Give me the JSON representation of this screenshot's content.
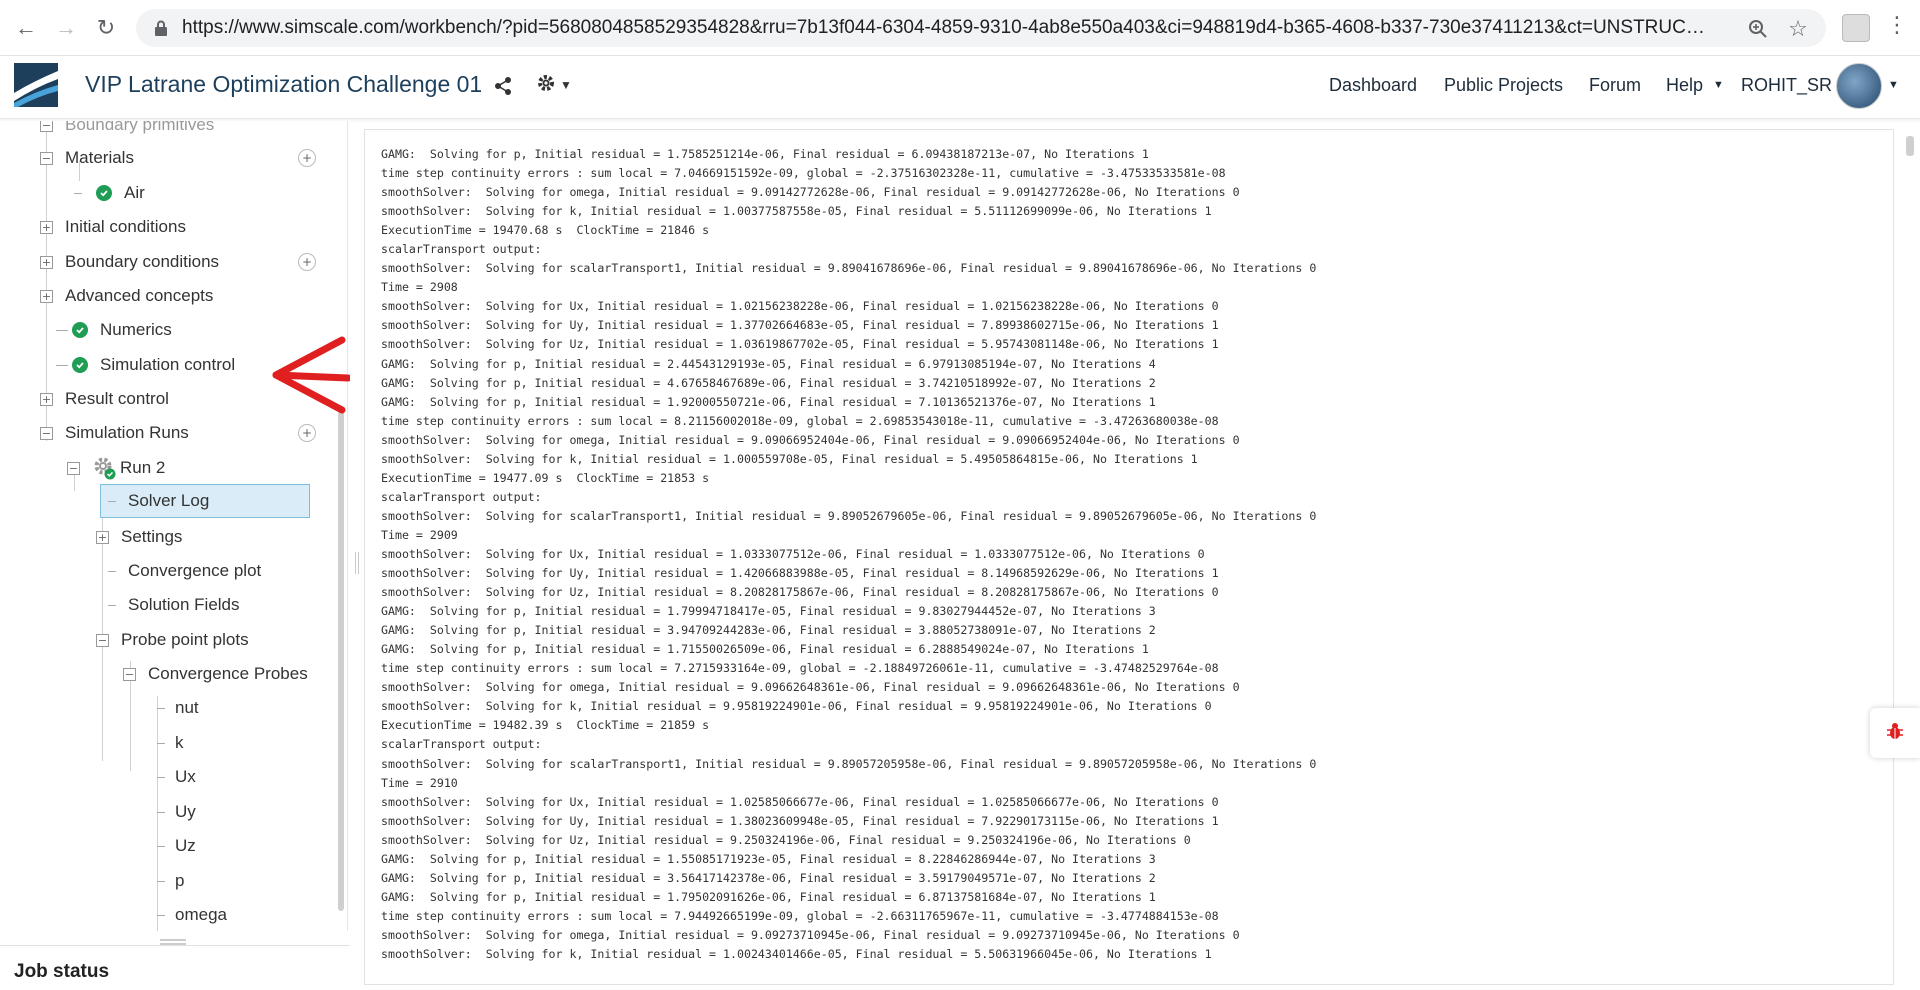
{
  "browser": {
    "url": "https://www.simscale.com/workbench/?pid=5680804858529354828&rru=7b13f044-6304-4859-9310-4ab8e550a403&ci=948819d4-b365-4608-b337-730e37411213&ct=UNSTRUCTURED_LOG&mt=SI..."
  },
  "header": {
    "project_title": "VIP Latrane Optimization Challenge 01",
    "nav": [
      "Dashboard",
      "Public Projects",
      "Forum",
      "Help"
    ],
    "username": "ROHIT_SR"
  },
  "sidebar": {
    "cut_item": "Boundary primitives",
    "materials": "Materials",
    "air": "Air",
    "initial_conditions": "Initial conditions",
    "boundary_conditions": "Boundary conditions",
    "advanced_concepts": "Advanced concepts",
    "numerics": "Numerics",
    "simulation_control": "Simulation control",
    "result_control": "Result control",
    "simulation_runs": "Simulation Runs",
    "run": "Run 2",
    "solver_log": "Solver Log",
    "settings": "Settings",
    "convergence_plot": "Convergence plot",
    "solution_fields": "Solution Fields",
    "probe_point_plots": "Probe point plots",
    "convergence_probes": "Convergence Probes",
    "probes": [
      "nut",
      "k",
      "Ux",
      "Uy",
      "Uz",
      "p",
      "omega"
    ]
  },
  "job_status": "Job status",
  "log": [
    "GAMG:  Solving for p, Initial residual = 1.7585251214e-06, Final residual = 6.09438187213e-07, No Iterations 1",
    "time step continuity errors : sum local = 7.04669151592e-09, global = -2.37516302328e-11, cumulative = -3.47533533581e-08",
    "smoothSolver:  Solving for omega, Initial residual = 9.09142772628e-06, Final residual = 9.09142772628e-06, No Iterations 0",
    "smoothSolver:  Solving for k, Initial residual = 1.00377587558e-05, Final residual = 5.51112699099e-06, No Iterations 1",
    "ExecutionTime = 19470.68 s  ClockTime = 21846 s",
    "scalarTransport output:",
    "smoothSolver:  Solving for scalarTransport1, Initial residual = 9.89041678696e-06, Final residual = 9.89041678696e-06, No Iterations 0",
    "Time = 2908",
    "smoothSolver:  Solving for Ux, Initial residual = 1.02156238228e-06, Final residual = 1.02156238228e-06, No Iterations 0",
    "smoothSolver:  Solving for Uy, Initial residual = 1.37702664683e-05, Final residual = 7.89938602715e-06, No Iterations 1",
    "smoothSolver:  Solving for Uz, Initial residual = 1.03619867702e-05, Final residual = 5.95743081148e-06, No Iterations 1",
    "GAMG:  Solving for p, Initial residual = 2.44543129193e-05, Final residual = 6.97913085194e-07, No Iterations 4",
    "GAMG:  Solving for p, Initial residual = 4.67658467689e-06, Final residual = 3.74210518992e-07, No Iterations 2",
    "GAMG:  Solving for p, Initial residual = 1.92000550721e-06, Final residual = 7.10136521376e-07, No Iterations 1",
    "time step continuity errors : sum local = 8.21156002018e-09, global = 2.69853543018e-11, cumulative = -3.47263680038e-08",
    "smoothSolver:  Solving for omega, Initial residual = 9.09066952404e-06, Final residual = 9.09066952404e-06, No Iterations 0",
    "smoothSolver:  Solving for k, Initial residual = 1.000559708e-05, Final residual = 5.49505864815e-06, No Iterations 1",
    "ExecutionTime = 19477.09 s  ClockTime = 21853 s",
    "scalarTransport output:",
    "smoothSolver:  Solving for scalarTransport1, Initial residual = 9.89052679605e-06, Final residual = 9.89052679605e-06, No Iterations 0",
    "Time = 2909",
    "smoothSolver:  Solving for Ux, Initial residual = 1.0333077512e-06, Final residual = 1.0333077512e-06, No Iterations 0",
    "smoothSolver:  Solving for Uy, Initial residual = 1.42066883988e-05, Final residual = 8.14968592629e-06, No Iterations 1",
    "smoothSolver:  Solving for Uz, Initial residual = 8.20828175867e-06, Final residual = 8.20828175867e-06, No Iterations 0",
    "GAMG:  Solving for p, Initial residual = 1.79994718417e-05, Final residual = 9.83027944452e-07, No Iterations 3",
    "GAMG:  Solving for p, Initial residual = 3.94709244283e-06, Final residual = 3.88052738091e-07, No Iterations 2",
    "GAMG:  Solving for p, Initial residual = 1.71550026509e-06, Final residual = 6.2888549024e-07, No Iterations 1",
    "time step continuity errors : sum local = 7.2715933164e-09, global = -2.18849726061e-11, cumulative = -3.47482529764e-08",
    "smoothSolver:  Solving for omega, Initial residual = 9.09662648361e-06, Final residual = 9.09662648361e-06, No Iterations 0",
    "smoothSolver:  Solving for k, Initial residual = 9.95819224901e-06, Final residual = 9.95819224901e-06, No Iterations 0",
    "ExecutionTime = 19482.39 s  ClockTime = 21859 s",
    "scalarTransport output:",
    "smoothSolver:  Solving for scalarTransport1, Initial residual = 9.89057205958e-06, Final residual = 9.89057205958e-06, No Iterations 0",
    "Time = 2910",
    "smoothSolver:  Solving for Ux, Initial residual = 1.02585066677e-06, Final residual = 1.02585066677e-06, No Iterations 0",
    "smoothSolver:  Solving for Uy, Initial residual = 1.38023609948e-05, Final residual = 7.92290173115e-06, No Iterations 1",
    "smoothSolver:  Solving for Uz, Initial residual = 9.250324196e-06, Final residual = 9.250324196e-06, No Iterations 0",
    "GAMG:  Solving for p, Initial residual = 1.55085171923e-05, Final residual = 8.22846286944e-07, No Iterations 3",
    "GAMG:  Solving for p, Initial residual = 3.56417142378e-06, Final residual = 3.59179049571e-07, No Iterations 2",
    "GAMG:  Solving for p, Initial residual = 1.79502091626e-06, Final residual = 6.87137581684e-07, No Iterations 1",
    "time step continuity errors : sum local = 7.94492665199e-09, global = -2.66311765967e-11, cumulative = -3.4774884153e-08",
    "smoothSolver:  Solving for omega, Initial residual = 9.09273710945e-06, Final residual = 9.09273710945e-06, No Iterations 0",
    "smoothSolver:  Solving for k, Initial residual = 1.00243401466e-05, Final residual = 5.50631966045e-06, No Iterations 1"
  ],
  "colors": {
    "accent": "#1d3f5c",
    "check": "#1f9d55",
    "selection": "#d9ecf7",
    "annotation": "#e02020"
  }
}
